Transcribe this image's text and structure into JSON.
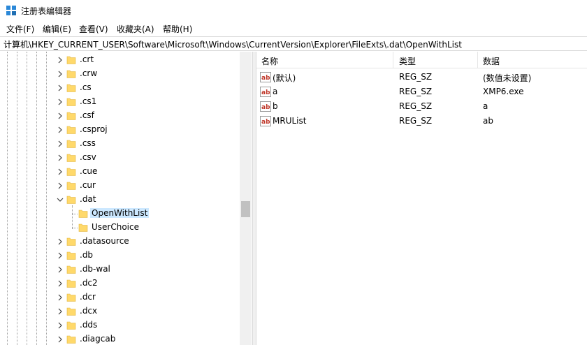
{
  "window": {
    "title": "注册表编辑器",
    "icon": "registry-editor-icon"
  },
  "menu": [
    "文件(F)",
    "编辑(E)",
    "查看(V)",
    "收藏夹(A)",
    "帮助(H)"
  ],
  "address": "计算机\\HKEY_CURRENT_USER\\Software\\Microsoft\\Windows\\CurrentVersion\\Explorer\\FileExts\\.dat\\OpenWithList",
  "tree": {
    "items": [
      {
        "label": ".crt",
        "expander": "chevron-right-icon"
      },
      {
        "label": ".crw",
        "expander": "chevron-right-icon"
      },
      {
        "label": ".cs",
        "expander": "chevron-right-icon"
      },
      {
        "label": ".cs1",
        "expander": "chevron-right-icon"
      },
      {
        "label": ".csf",
        "expander": "chevron-right-icon"
      },
      {
        "label": ".csproj",
        "expander": "chevron-right-icon"
      },
      {
        "label": ".css",
        "expander": "chevron-right-icon"
      },
      {
        "label": ".csv",
        "expander": "chevron-right-icon"
      },
      {
        "label": ".cue",
        "expander": "chevron-right-icon"
      },
      {
        "label": ".cur",
        "expander": "chevron-right-icon"
      },
      {
        "label": ".dat",
        "expander": "chevron-down-icon"
      },
      {
        "label": "OpenWithList",
        "selected": true
      },
      {
        "label": "UserChoice"
      },
      {
        "label": ".datasource",
        "expander": "chevron-right-icon"
      },
      {
        "label": ".db",
        "expander": "chevron-right-icon"
      },
      {
        "label": ".db-wal",
        "expander": "chevron-right-icon"
      },
      {
        "label": ".dc2",
        "expander": "chevron-right-icon"
      },
      {
        "label": ".dcr",
        "expander": "chevron-right-icon"
      },
      {
        "label": ".dcx",
        "expander": "chevron-right-icon"
      },
      {
        "label": ".dds",
        "expander": "chevron-right-icon"
      },
      {
        "label": ".diagcab",
        "expander": "chevron-right-icon"
      }
    ],
    "folder_icon": "folder-icon",
    "selection_color": "#cce8ff"
  },
  "list": {
    "columns": [
      "名称",
      "类型",
      "数据"
    ],
    "rows": [
      {
        "name": "(默认)",
        "type": "REG_SZ",
        "data": "(数值未设置)"
      },
      {
        "name": "a",
        "type": "REG_SZ",
        "data": "XMP6.exe"
      },
      {
        "name": "b",
        "type": "REG_SZ",
        "data": "a"
      },
      {
        "name": "MRUList",
        "type": "REG_SZ",
        "data": "ab"
      }
    ],
    "value_icon": "string-value-icon"
  }
}
